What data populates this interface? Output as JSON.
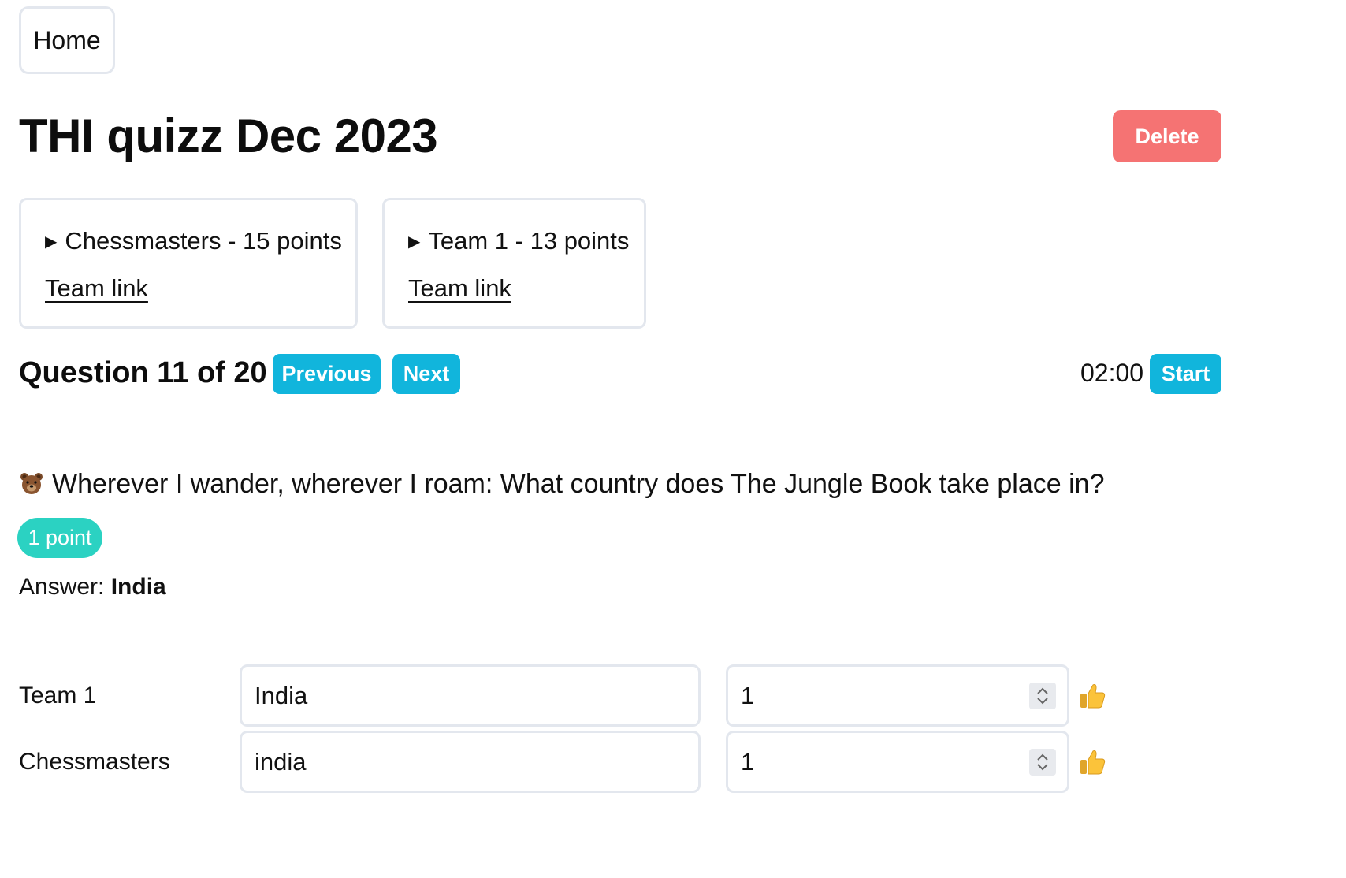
{
  "nav": {
    "home_label": "Home"
  },
  "header": {
    "title": "THI quizz Dec 2023",
    "delete_label": "Delete"
  },
  "teams": [
    {
      "summary": "Chessmasters - 15 points",
      "link_label": "Team link"
    },
    {
      "summary": "Team 1 - 13 points",
      "link_label": "Team link"
    }
  ],
  "question_bar": {
    "heading": "Question 11 of 20",
    "previous_label": "Previous",
    "next_label": "Next",
    "timer": "02:00",
    "start_label": "Start"
  },
  "question": {
    "icon": "bear-icon",
    "text": "Wherever I wander, wherever I roam: What country does The Jungle Book take place in?",
    "points_badge": "1 point",
    "answer_prefix": "Answer:",
    "answer": "India"
  },
  "responses": [
    {
      "team": "Team 1",
      "answer": "India",
      "score": "1",
      "icon": "thumbs-up-icon"
    },
    {
      "team": "Chessmasters",
      "answer": "india",
      "score": "1",
      "icon": "thumbs-up-icon"
    }
  ],
  "colors": {
    "primary": "#11b5dc",
    "danger": "#f57373",
    "badge": "#2bd2c2",
    "border": "#e3e7ee"
  }
}
